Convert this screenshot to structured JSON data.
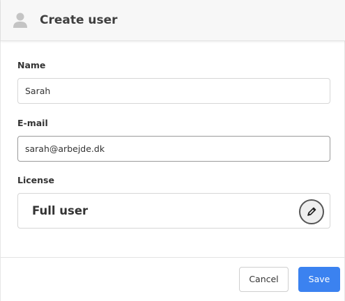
{
  "dialog": {
    "title": "Create user",
    "title_icon": "user-icon"
  },
  "form": {
    "name": {
      "label": "Name",
      "value": "Sarah"
    },
    "email": {
      "label": "E-mail",
      "value": "sarah@arbejde.dk"
    },
    "license": {
      "label": "License",
      "value": "Full user",
      "edit_icon": "pencil-icon"
    }
  },
  "footer": {
    "cancel_label": "Cancel",
    "save_label": "Save"
  },
  "colors": {
    "primary": "#3b82f0",
    "header_bg": "#f7f7f7"
  }
}
